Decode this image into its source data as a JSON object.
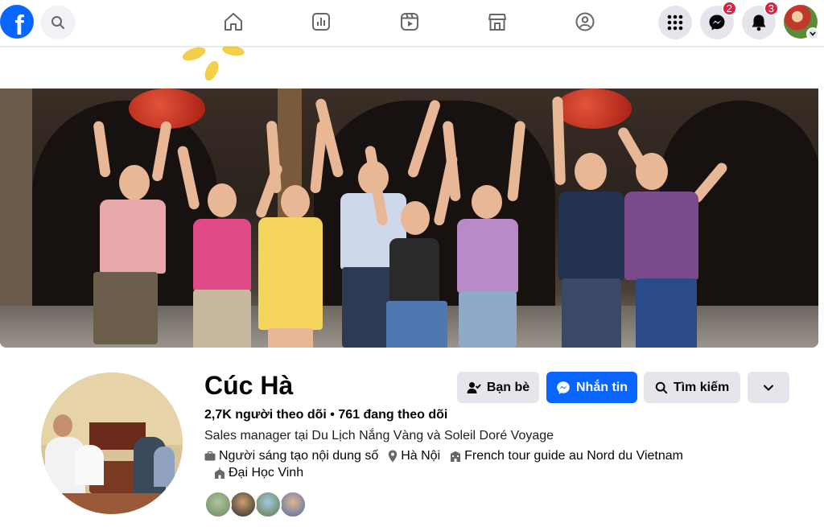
{
  "nav": {
    "logo_letter": "f",
    "messenger_badge": "2",
    "notifications_badge": "3",
    "icons": [
      "home-icon",
      "dashboard-icon",
      "reels-icon",
      "marketplace-icon",
      "groups-icon"
    ]
  },
  "profile": {
    "name": "Cúc Hà",
    "followers_line": "2,7K người theo dõi • 761 đang theo dõi",
    "bio": "Sales manager tại Du Lịch Nắng Vàng và Soleil Doré Voyage",
    "creator": "Người sáng tạo nội dung số",
    "location": "Hà Nội",
    "work": "French tour guide au Nord du Vietnam",
    "education": "Đại Học Vinh"
  },
  "actions": {
    "friends": "Bạn bè",
    "message": "Nhắn tin",
    "search": "Tìm kiếm"
  },
  "colors": {
    "accent": "#0866ff",
    "badge": "#e41e3f",
    "button_gray": "#e4e6eb"
  }
}
